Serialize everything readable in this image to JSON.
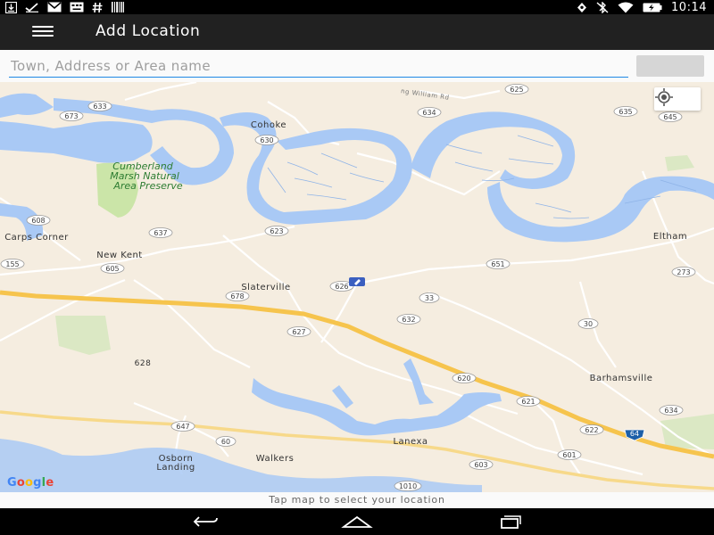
{
  "status_bar": {
    "time": "10:14",
    "left_icons": [
      "download-icon",
      "checkmark-icon",
      "gmail-icon",
      "keyboard-icon",
      "hash-icon",
      "barcode-icon"
    ],
    "right_icons": [
      "location-pin-icon",
      "bluetooth-off-icon",
      "wifi-icon",
      "battery-icon"
    ]
  },
  "app_bar": {
    "title": "Add Location",
    "menu_icon": "menu-icon"
  },
  "search": {
    "placeholder": "Town, Address or Area name",
    "value": ""
  },
  "map": {
    "places": {
      "cohoke": "Cohoke",
      "cumberland_1": "Cumberland",
      "cumberland_2": "Marsh Natural",
      "cumberland_3": "Area Preserve",
      "carps_corner": "Carps Corner",
      "new_kent": "New Kent",
      "slaterville": "Slaterville",
      "eltham": "Eltham",
      "barhamsville": "Barhamsville",
      "lanexa": "Lanexa",
      "walkers": "Walkers",
      "osborn_1": "Osborn",
      "osborn_2": "Landing",
      "road_628": "628",
      "road_william": "ng William Rd"
    },
    "shields": {
      "s625": "625",
      "s633": "633",
      "s673": "673",
      "s634": "634",
      "s635": "635",
      "s645": "645",
      "s630": "630",
      "s608": "608",
      "s637": "637",
      "s623": "623",
      "s155": "155",
      "s605": "605",
      "s651": "651",
      "s273": "273",
      "s626": "626",
      "s678": "678",
      "s33": "33",
      "s632": "632",
      "s627": "627",
      "s30": "30",
      "s620": "620",
      "s621": "621",
      "s634b": "634",
      "s647": "647",
      "s60": "60",
      "s622": "622",
      "s64": "64",
      "s601": "601",
      "s603": "603",
      "s1010": "1010"
    },
    "logo": "Google",
    "logo_colors": [
      "#4285f4",
      "#ea4335",
      "#fbbc05",
      "#4285f4",
      "#34a853",
      "#ea4335"
    ],
    "water_color": "#a9c9f5",
    "land_color": "#f5ede0",
    "park_color": "#cbe5a8"
  },
  "hint": "Tap map to select your location",
  "nav": {
    "back_icon": "back-icon",
    "home_icon": "home-icon",
    "recents_icon": "recents-icon"
  }
}
